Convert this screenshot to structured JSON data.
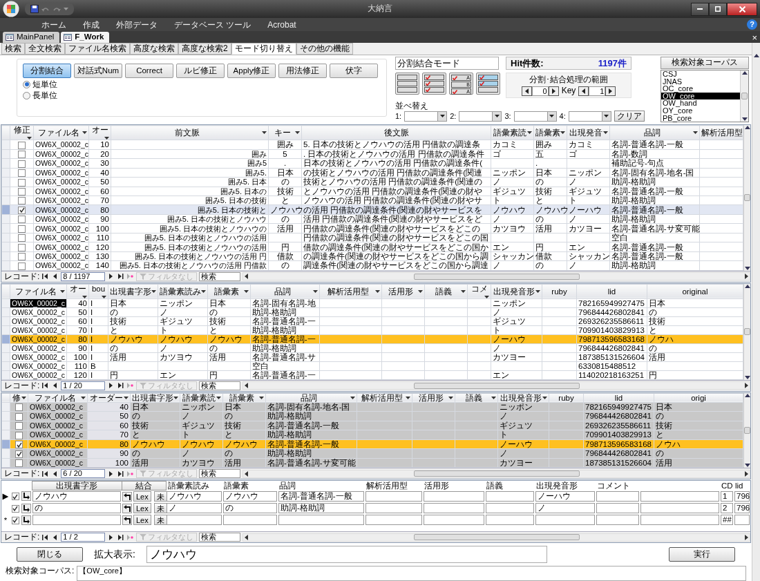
{
  "window": {
    "title": "大納言"
  },
  "ribbon_tabs": [
    "ホーム",
    "作成",
    "外部データ",
    "データベース ツール",
    "Acrobat"
  ],
  "help_button": "?",
  "document_tabs": [
    {
      "label": "MainPanel",
      "selected": false
    },
    {
      "label": "F_Work",
      "selected": true
    }
  ],
  "document_close": "×",
  "form_tabs": [
    {
      "label": "検索",
      "selected": false
    },
    {
      "label": "全文検索",
      "selected": false
    },
    {
      "label": "ファイル名検索",
      "selected": false
    },
    {
      "label": "高度な検索",
      "selected": false
    },
    {
      "label": "高度な検索2",
      "selected": false
    },
    {
      "label": "モード切り替え",
      "selected": true
    },
    {
      "label": "その他の機能",
      "selected": false
    }
  ],
  "mode_buttons": [
    {
      "label": "分割結合",
      "selected": true
    },
    {
      "label": "対話式Num",
      "selected": false
    },
    {
      "label": "Correct",
      "selected": false
    },
    {
      "label": "ルビ修正",
      "selected": false
    },
    {
      "label": "Apply修正",
      "selected": false
    },
    {
      "label": "用法修正",
      "selected": false
    },
    {
      "label": "伏字",
      "selected": false
    }
  ],
  "unit_options": [
    {
      "label": "短単位",
      "selected": true
    },
    {
      "label": "長単位",
      "selected": false
    }
  ],
  "mode_field": {
    "value": "分割結合モード"
  },
  "layout_buttons": [
    {
      "kind": "plain"
    },
    {
      "kind": "checked"
    },
    {
      "kind": "lettered",
      "letters": [
        "A",
        "B",
        "A"
      ]
    },
    {
      "kind": "shaded"
    }
  ],
  "sort": {
    "label": "並べ替え",
    "slots": [
      "1:",
      "2:",
      "3:",
      "4:"
    ],
    "clear_button": "クリア"
  },
  "hit": {
    "label": "Hit件数:",
    "count": "1197件"
  },
  "range": {
    "label": "分割･結合処理の範囲",
    "from": "0",
    "key_label": "Key",
    "to": "1"
  },
  "corpus": {
    "header": "検索対象コーパス",
    "items": [
      {
        "label": "CSJ",
        "selected": false
      },
      {
        "label": "JNAS",
        "selected": false
      },
      {
        "label": "OC_core",
        "selected": false
      },
      {
        "label": "OW_core",
        "selected": true
      },
      {
        "label": "OW_hand",
        "selected": false
      },
      {
        "label": "OY_core",
        "selected": false
      },
      {
        "label": "PB_core",
        "selected": false
      }
    ]
  },
  "grid_main": {
    "columns": [
      "修正",
      "ファイル名",
      "オー",
      "前文脈",
      "キー",
      "後文脈",
      "語彙素読",
      "語彙素",
      "出現発音",
      "品詞",
      "解析活用型"
    ],
    "rows": [
      {
        "selected": false,
        "checked": false,
        "file": "OW6X_00002_c",
        "order": "10",
        "key": "囲み",
        "post_context": "5. 日本の技術とノウハウの活用 円借款の調達条",
        "lemma_reading": "カコミ",
        "lemma": "囲み",
        "pronunciation": "カコミ",
        "pos": "名詞-普通名詞-一般"
      },
      {
        "selected": false,
        "checked": false,
        "file": "OW6X_00002_c",
        "order": "20",
        "pre_context": "囲み",
        "key": "5",
        "post_context": ". 日本の技術とノウハウの活用 円借款の調達条件",
        "lemma_reading": "ゴ",
        "lemma": "五",
        "pronunciation": "ゴ",
        "pos": "名詞-数詞"
      },
      {
        "selected": false,
        "checked": false,
        "file": "OW6X_00002_c",
        "order": "30",
        "pre_context": "囲み5",
        "key": ".",
        "post_context": "日本の技術とノウハウの活用 円借款の調達条件(",
        "lemma": ".",
        "pos": "補助記号-句点"
      },
      {
        "selected": false,
        "checked": false,
        "file": "OW6X_00002_c",
        "order": "40",
        "pre_context": "囲み5.",
        "key": "日本",
        "post_context": "の技術とノウハウの活用 円借款の調達条件(関連",
        "lemma_reading": "ニッポン",
        "lemma": "日本",
        "pronunciation": "ニッポン",
        "pos": "名詞-固有名詞-地名-国"
      },
      {
        "selected": false,
        "checked": false,
        "file": "OW6X_00002_c",
        "order": "50",
        "pre_context": "囲み5. 日本",
        "key": "の",
        "post_context": "技術とノウハウの活用 円借款の調達条件(関連の",
        "lemma_reading": "ノ",
        "lemma": "の",
        "pronunciation": "ノ",
        "pos": "助詞-格助詞"
      },
      {
        "selected": false,
        "checked": false,
        "file": "OW6X_00002_c",
        "order": "60",
        "pre_context": "囲み5. 日本の",
        "key": "技術",
        "post_context": "とノウハウの活用 円借款の調達条件(関連の財や",
        "lemma_reading": "ギジュツ",
        "lemma": "技術",
        "pronunciation": "ギジュツ",
        "pos": "名詞-普通名詞-一般"
      },
      {
        "selected": false,
        "checked": false,
        "file": "OW6X_00002_c",
        "order": "70",
        "pre_context": "囲み5. 日本の技術",
        "key": "と",
        "post_context": "ノウハウの活用 円借款の調達条件(関連の財やサ",
        "lemma_reading": "ト",
        "lemma": "と",
        "pronunciation": "ト",
        "pos": "助詞-格助詞"
      },
      {
        "selected": true,
        "checked": true,
        "file": "OW6X_00002_c",
        "order": "80",
        "pre_context": "囲み5. 日本の技術と",
        "key": "ノウハウ",
        "post_context": "の活用 円借款の調達条件(関連の財やサービスを",
        "lemma_reading": "ノウハウ",
        "lemma": "ノウハウ",
        "pronunciation": "ノーハウ",
        "pos": "名詞-普通名詞-一般"
      },
      {
        "selected": false,
        "checked": false,
        "file": "OW6X_00002_c",
        "order": "90",
        "pre_context": "囲み5. 日本の技術とノウハウ",
        "key": "の",
        "post_context": "活用 円借款の調達条件(関連の財やサービスをど",
        "lemma_reading": "ノ",
        "lemma": "の",
        "pronunciation": "ノ",
        "pos": "助詞-格助詞"
      },
      {
        "selected": false,
        "checked": false,
        "file": "OW6X_00002_c",
        "order": "100",
        "pre_context": "囲み5. 日本の技術とノウハウの",
        "key": "活用",
        "post_context": "円借款の調達条件(関連の財やサービスをどこの",
        "lemma_reading": "カツヨウ",
        "lemma": "活用",
        "pronunciation": "カツヨー",
        "pos": "名詞-普通名詞-サ変可能"
      },
      {
        "selected": false,
        "checked": false,
        "file": "OW6X_00002_c",
        "order": "110",
        "pre_context": "囲み5. 日本の技術とノウハウの活用",
        "post_context": "円借款の調達条件(関連の財やサービスをどこの国",
        "pos": "空白"
      },
      {
        "selected": false,
        "checked": false,
        "file": "OW6X_00002_c",
        "order": "120",
        "pre_context": "囲み5. 日本の技術とノウハウの活用",
        "key": "円",
        "post_context": "借款の調達条件(関連の財やサービスをどこの国か",
        "lemma_reading": "エン",
        "lemma": "円",
        "pronunciation": "エン",
        "pos": "名詞-普通名詞-一般"
      },
      {
        "selected": false,
        "checked": false,
        "file": "OW6X_00002_c",
        "order": "130",
        "pre_context": "囲み5. 日本の技術とノウハウの活用 円",
        "key": "借款",
        "post_context": "の調達条件(関連の財やサービスをどこの国から調",
        "lemma_reading": "シャッカン",
        "lemma": "借款",
        "pronunciation": "シャッカン",
        "pos": "名詞-普通名詞-一般"
      },
      {
        "selected": false,
        "checked": false,
        "file": "OW6X_00002_c",
        "order": "140",
        "pre_context": "囲み5. 日本の技術とノウハウの活用 円借款",
        "key": "の",
        "post_context": "調達条件(関連の財やサービスをどこの国から調達",
        "lemma_reading": "ノ",
        "lemma": "の",
        "pronunciation": "ノ",
        "pos": "助詞-格助詞"
      }
    ],
    "nav": {
      "label": "レコード:",
      "position": "8 / 1197",
      "filter": {
        "label": "フィルタなし",
        "disabled": true
      },
      "search": "検索"
    }
  },
  "grid_words": {
    "columns": [
      "ファイル名",
      "オー",
      "bou",
      "出現書字形",
      "語彙素読み",
      "語彙素",
      "品詞",
      "解析活用型",
      "活用形",
      "語義",
      "コメ",
      "出現発音形",
      "ruby",
      "lid",
      "original"
    ],
    "rows": [
      {
        "current": true,
        "selected": false,
        "file": "OW6X_00002_c",
        "order": "40",
        "boundary": "I",
        "surface": "日本",
        "lemma_reading": "ニッポン",
        "lemma": "日本",
        "pos": "名詞-固有名詞-地",
        "pronunciation": "ニッポン",
        "lid": "782165949927475",
        "original": "日本"
      },
      {
        "current": false,
        "selected": false,
        "file": "OW6X_00002_c",
        "order": "50",
        "boundary": "I",
        "surface": "の",
        "lemma_reading": "ノ",
        "lemma": "の",
        "pos": "助詞-格助詞",
        "pronunciation": "ノ",
        "lid": "796844426802841",
        "original": "の"
      },
      {
        "current": false,
        "selected": false,
        "file": "OW6X_00002_c",
        "order": "60",
        "boundary": "I",
        "surface": "技術",
        "lemma_reading": "ギジュツ",
        "lemma": "技術",
        "pos": "名詞-普通名詞-一",
        "pronunciation": "ギジュツ",
        "lid": "269326235586611",
        "original": "技術"
      },
      {
        "current": false,
        "selected": false,
        "file": "OW6X_00002_c",
        "order": "70",
        "boundary": "I",
        "surface": "と",
        "lemma_reading": "ト",
        "lemma": "と",
        "pos": "助詞-格助詞",
        "pronunciation": "ト",
        "lid": "709901403829913",
        "original": "と"
      },
      {
        "current": false,
        "selected": true,
        "file": "OW6X_00002_c",
        "order": "80",
        "boundary": "I",
        "surface": "ノウハウ",
        "lemma_reading": "ノウハウ",
        "lemma": "ノウハウ",
        "pos": "名詞-普通名詞-一",
        "pronunciation": "ノーハウ",
        "lid": "798713596583168",
        "original": "ノウハ"
      },
      {
        "current": false,
        "selected": false,
        "file": "OW6X_00002_c",
        "order": "90",
        "boundary": "I",
        "surface": "の",
        "lemma_reading": "ノ",
        "lemma": "の",
        "pos": "助詞-格助詞",
        "pronunciation": "ノ",
        "lid": "796844426802841",
        "original": "の"
      },
      {
        "current": false,
        "selected": false,
        "file": "OW6X_00002_c",
        "order": "100",
        "boundary": "I",
        "surface": "活用",
        "lemma_reading": "カツヨウ",
        "lemma": "活用",
        "pos": "名詞-普通名詞-サ",
        "pronunciation": "カツヨー",
        "lid": "187385131526604",
        "original": "活用"
      },
      {
        "current": false,
        "selected": false,
        "file": "OW6X_00002_c",
        "order": "110",
        "boundary": "B",
        "pos": "空白",
        "lid": "6330815488512"
      },
      {
        "current": false,
        "selected": false,
        "file": "OW6X_00002_c",
        "order": "120",
        "boundary": "I",
        "surface": "円",
        "lemma_reading": "エン",
        "lemma": "円",
        "pos": "名詞-普通名詞-一",
        "pronunciation": "エン",
        "lid": "114020218163251",
        "original": "円"
      }
    ],
    "nav": {
      "label": "レコード:",
      "position": "1 / 20",
      "filter": {
        "label": "フィルタなし",
        "disabled": true
      },
      "search": "検索"
    }
  },
  "grid_edit": {
    "columns": [
      "修",
      "ファイル名",
      "オーダー",
      "出現書字形",
      "語彙素読",
      "語彙素",
      "品詞",
      "解析活用型",
      "活用形",
      "語義",
      "出現発音形",
      "ruby",
      "lid",
      "origi"
    ],
    "rows": [
      {
        "selected": false,
        "checked": false,
        "file": "OW6X_00002_c",
        "order": "40",
        "surface": "日本",
        "lemma_reading": "ニッポン",
        "lemma": "日本",
        "pos": "名詞-固有名詞-地名-国",
        "pronunciation": "ニッポン",
        "lid": "782165949927475",
        "original": "日本"
      },
      {
        "selected": false,
        "checked": false,
        "file": "OW6X_00002_c",
        "order": "50",
        "surface": "の",
        "lemma_reading": "ノ",
        "lemma": "の",
        "pos": "助詞-格助詞",
        "pronunciation": "ノ",
        "lid": "796844426802841",
        "original": "の"
      },
      {
        "selected": false,
        "checked": false,
        "file": "OW6X_00002_c",
        "order": "60",
        "surface": "技術",
        "lemma_reading": "ギジュツ",
        "lemma": "技術",
        "pos": "名詞-普通名詞-一般",
        "pronunciation": "ギジュツ",
        "lid": "269326235586611",
        "original": "技術"
      },
      {
        "selected": false,
        "checked": false,
        "file": "OW6X_00002_c",
        "order": "70",
        "surface": "と",
        "lemma_reading": "ト",
        "lemma": "と",
        "pos": "助詞-格助詞",
        "pronunciation": "ト",
        "lid": "709901403829913",
        "original": "と"
      },
      {
        "selected": true,
        "checked": true,
        "file": "OW6X_00002_c",
        "order": "80",
        "surface": "ノウハウ",
        "lemma_reading": "ノウハウ",
        "lemma": "ノウハウ",
        "pos": "名詞-普通名詞-一般",
        "pronunciation": "ノーハウ",
        "lid": "798713596583168",
        "original": "ノウハ"
      },
      {
        "selected": false,
        "checked": true,
        "file": "OW6X_00002_c",
        "order": "90",
        "surface": "の",
        "lemma_reading": "ノ",
        "lemma": "の",
        "pos": "助詞-格助詞",
        "pronunciation": "ノ",
        "lid": "796844426802841",
        "original": "の"
      },
      {
        "selected": false,
        "checked": false,
        "file": "OW6X_00002_c",
        "order": "100",
        "surface": "活用",
        "lemma_reading": "カツヨウ",
        "lemma": "活用",
        "pos": "名詞-普通名詞-サ変可能",
        "pronunciation": "カツヨー",
        "lid": "187385131526604",
        "original": "活用"
      }
    ],
    "nav": {
      "label": "レコード:",
      "position": "6 / 20",
      "filter": {
        "label": "フィルタなし",
        "disabled": true
      },
      "search": "検索"
    }
  },
  "grid_split": {
    "columns": [
      "出現書字形",
      "結合",
      "語彙素読み",
      "語彙素",
      "品詞",
      "解析活用型",
      "活用形",
      "語義",
      "出現発音形",
      "コメント",
      "CD",
      "lid"
    ],
    "rows": [
      {
        "marker": "▶",
        "checked": true,
        "surface": "ノウハウ",
        "lex_button": "Lex",
        "status_button": "未",
        "lemma_reading": "ノウハウ",
        "lemma": "ノウハウ",
        "pos": "名詞-普通名詞-一般",
        "pronunciation": "ノーハウ",
        "cd": "1",
        "lid": "796"
      },
      {
        "checked": true,
        "surface": "の",
        "lex_button": "Lex",
        "status_button": "未",
        "lemma_reading": "ノ",
        "lemma": "の",
        "pos": "助詞-格助詞",
        "pronunciation": "ノ",
        "cd": "2",
        "lid": "796"
      },
      {
        "marker": "*",
        "checked": true,
        "lex_button": "Lex",
        "status_button": "未",
        "cd": "##"
      }
    ],
    "nav": {
      "label": "レコード:",
      "position": "1 / 2",
      "filter": {
        "label": "フィルタなし",
        "disabled": true
      },
      "search": "検索"
    }
  },
  "close_button": "閉じる",
  "zoom_display": {
    "label": "拡大表示:",
    "value": "ノウハウ"
  },
  "run_button": "実行",
  "corpus_status": {
    "label": "検索対象コーパス:",
    "value": "【OW_core】"
  }
}
